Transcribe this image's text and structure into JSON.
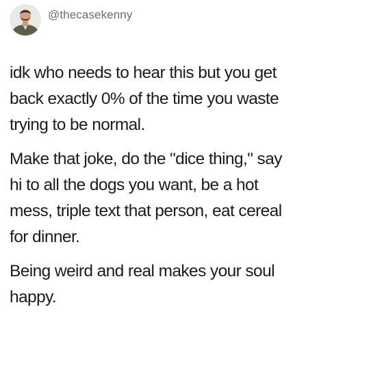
{
  "post": {
    "username": "@thecasekenny",
    "paragraphs": [
      {
        "lines": [
          "idk who needs to hear this but you get",
          "back exactly 0% of the time you waste",
          "trying to be normal."
        ]
      },
      {
        "lines": [
          "Make that joke, do the \"dice thing,\" say",
          "hi to all the dogs you want, be a hot",
          "mess, triple text that person, eat cereal",
          "for dinner."
        ]
      },
      {
        "lines": [
          "Being weird and real makes your soul",
          "happy."
        ]
      }
    ]
  }
}
